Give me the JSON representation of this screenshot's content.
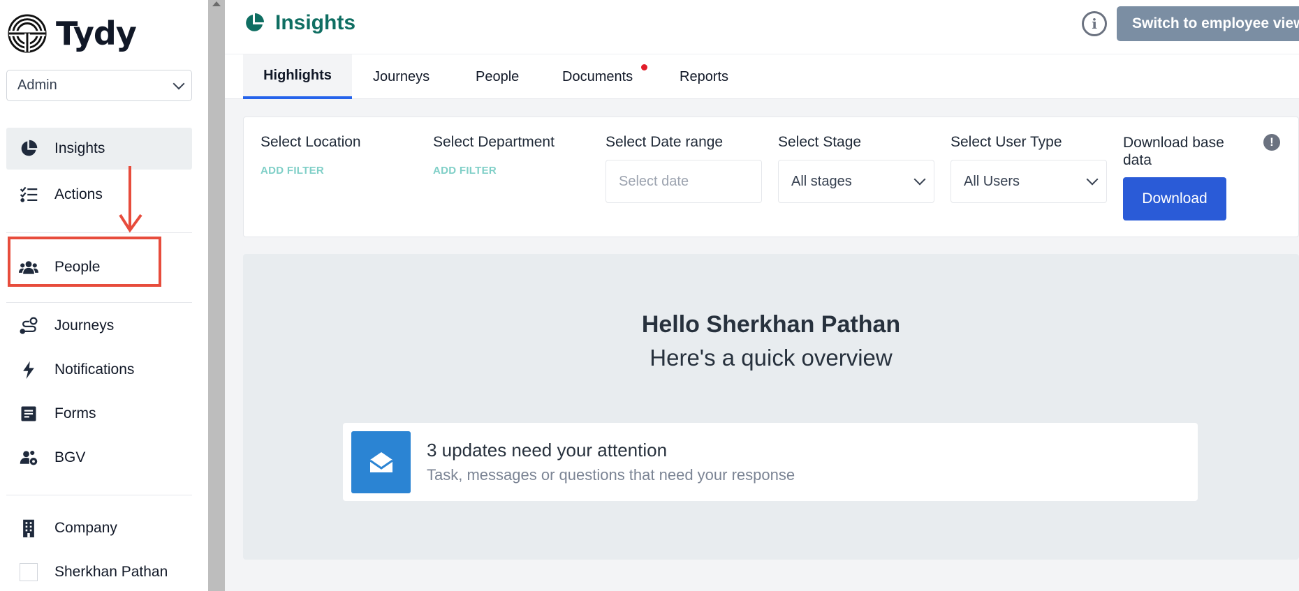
{
  "brand": {
    "name": "Tydy"
  },
  "role_select": {
    "value": "Admin"
  },
  "sidebar": {
    "items": [
      {
        "label": "Insights",
        "icon": "pie-chart-icon",
        "active": true
      },
      {
        "label": "Actions",
        "icon": "checklist-icon"
      },
      {
        "label": "People",
        "icon": "people-group-icon"
      },
      {
        "label": "Journeys",
        "icon": "route-icon"
      },
      {
        "label": "Notifications",
        "icon": "bolt-icon"
      },
      {
        "label": "Forms",
        "icon": "form-icon"
      },
      {
        "label": "BGV",
        "icon": "users-cog-icon"
      },
      {
        "label": "Company",
        "icon": "building-icon"
      },
      {
        "label": "Sherkhan Pathan",
        "icon": "user-avatar-icon"
      }
    ]
  },
  "header": {
    "title": "Insights",
    "info_icon": "info-icon",
    "switch_label": "Switch to employee view"
  },
  "tabs": [
    {
      "label": "Highlights",
      "active": true
    },
    {
      "label": "Journeys"
    },
    {
      "label": "People"
    },
    {
      "label": "Documents",
      "has_notification_dot": true
    },
    {
      "label": "Reports"
    }
  ],
  "filters": {
    "location": {
      "label": "Select Location",
      "action": "ADD FILTER"
    },
    "department": {
      "label": "Select Department",
      "action": "ADD FILTER"
    },
    "date_range": {
      "label": "Select Date range",
      "placeholder": "Select date"
    },
    "stage": {
      "label": "Select Stage",
      "value": "All stages"
    },
    "user_type": {
      "label": "Select User Type",
      "value": "All Users"
    },
    "download": {
      "label": "Download base data",
      "button": "Download"
    }
  },
  "overview": {
    "greeting": "Hello Sherkhan Pathan",
    "subtitle": "Here's a quick overview",
    "update_title": "3 updates need your attention",
    "update_subtitle": "Task, messages or questions that need your response"
  },
  "colors": {
    "brand_green": "#0f6e62",
    "tab_active": "#2563eb",
    "download_button": "#2a5bd7",
    "switch_button": "#7b8ea3",
    "annotation_red": "#e74c3c",
    "mail_icon_bg": "#2b84d3"
  }
}
